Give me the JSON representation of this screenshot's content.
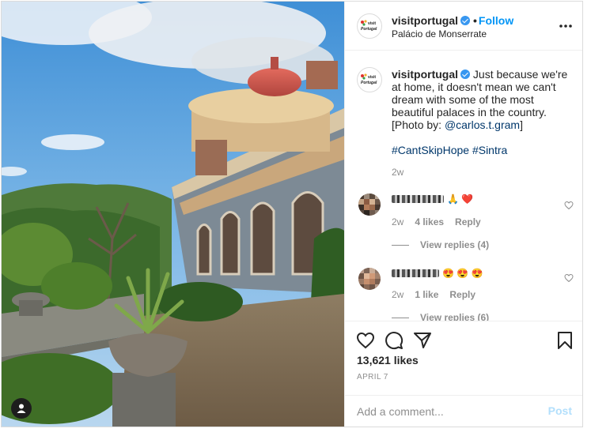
{
  "post": {
    "username": "visitportugal",
    "follow_label": "Follow",
    "separator": "•",
    "location": "Palácio de Monserrate",
    "avatar_logo_text": "visit Portugal",
    "more_icon": "more-horizontal-icon",
    "user_tag_icon": "person-icon"
  },
  "caption": {
    "username": "visitportugal",
    "text_part1": "Just because we're at home, it doesn't mean we can't dream with some of the most beautiful palaces in the country. [Photo by: ",
    "mention": "@carlos.t.gram",
    "text_part2": "]",
    "hashtags": "#CantSkipHope #Sintra",
    "time": "2w"
  },
  "comments": [
    {
      "emojis": "🙏 ❤️",
      "time": "2w",
      "likes": "4 likes",
      "reply_label": "Reply",
      "view_replies": "View replies (4)"
    },
    {
      "emojis": "😍 😍 😍",
      "time": "2w",
      "likes": "1 like",
      "reply_label": "Reply",
      "view_replies": "View replies (6)"
    }
  ],
  "actions": {
    "likes": "13,621 likes",
    "date": "APRIL 7",
    "icons": [
      "heart-icon",
      "comment-icon",
      "share-icon",
      "bookmark-icon"
    ]
  },
  "add_comment": {
    "placeholder": "Add a comment...",
    "post_label": "Post"
  },
  "colors": {
    "link": "#00376b",
    "follow": "#0095f6",
    "post_disabled": "#b2dffc",
    "verified": "#3897f0",
    "muted": "#8e8e8e"
  }
}
